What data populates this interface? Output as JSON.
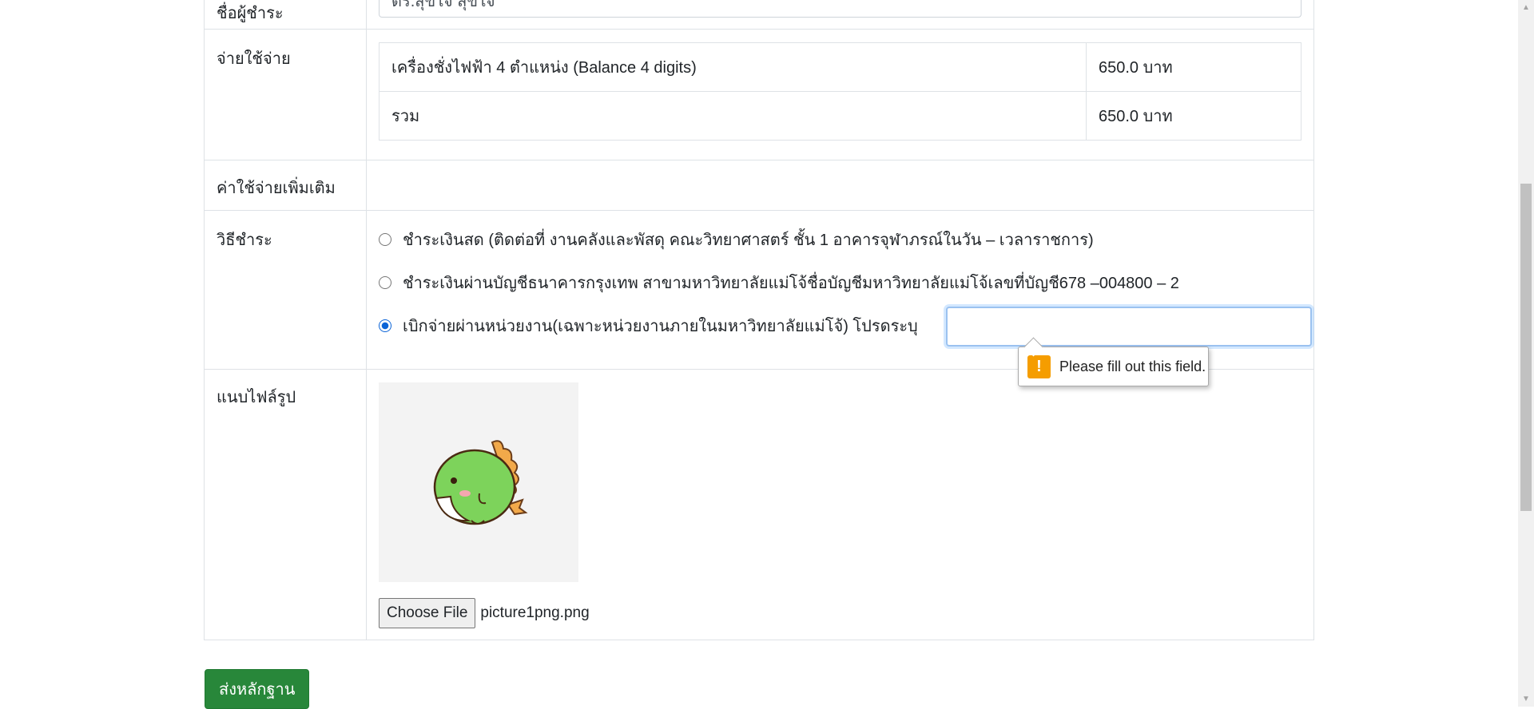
{
  "form": {
    "payer": {
      "label": "ชื่อผู้ชำระ",
      "value": "ดร.สุขใจ สุขใจ"
    },
    "expenses": {
      "label": "จ่ายใช้จ่าย",
      "rows": [
        {
          "item": "เครื่องชั่งไฟฟ้า 4 ตำแหน่ง (Balance 4 digits)",
          "amount": "650.0 บาท"
        },
        {
          "item": "รวม",
          "amount": "650.0 บาท"
        }
      ]
    },
    "extra": {
      "label": "ค่าใช้จ่ายเพิ่มเติม"
    },
    "payment": {
      "label": "วิธีชำระ",
      "options": [
        {
          "text": "ชำระเงินสด (ติดต่อที่ งานคลังและพัสดุ คณะวิทยาศาสตร์ ชั้น 1 อาคารจุฬาภรณ์ในวัน – เวลาราชการ)",
          "checked": false
        },
        {
          "text": "ชำระเงินผ่านบัญชีธนาคารกรุงเทพ สาขามหาวิทยาลัยแม่โจ้ชื่อบัญชีมหาวิทยาลัยแม่โจ้เลขที่บัญชี678 –004800 – 2",
          "checked": false
        },
        {
          "text": "เบิกจ่ายผ่านหน่วยงาน(เฉพาะหน่วยงานภายในมหาวิทยาลัยแม่โจ้) โปรดระบุ",
          "checked": true
        }
      ],
      "unit_input_value": "",
      "validation_tooltip": "Please fill out this field."
    },
    "attachment": {
      "label": "แนบไฟล์รูป",
      "choose_button": "Choose File",
      "file_name": "picture1png.png"
    }
  },
  "submit_label": "ส่งหลักฐาน",
  "colors": {
    "submit": "#28873a",
    "warning": "#f59d00",
    "radio_checked": "#0b64d7"
  }
}
